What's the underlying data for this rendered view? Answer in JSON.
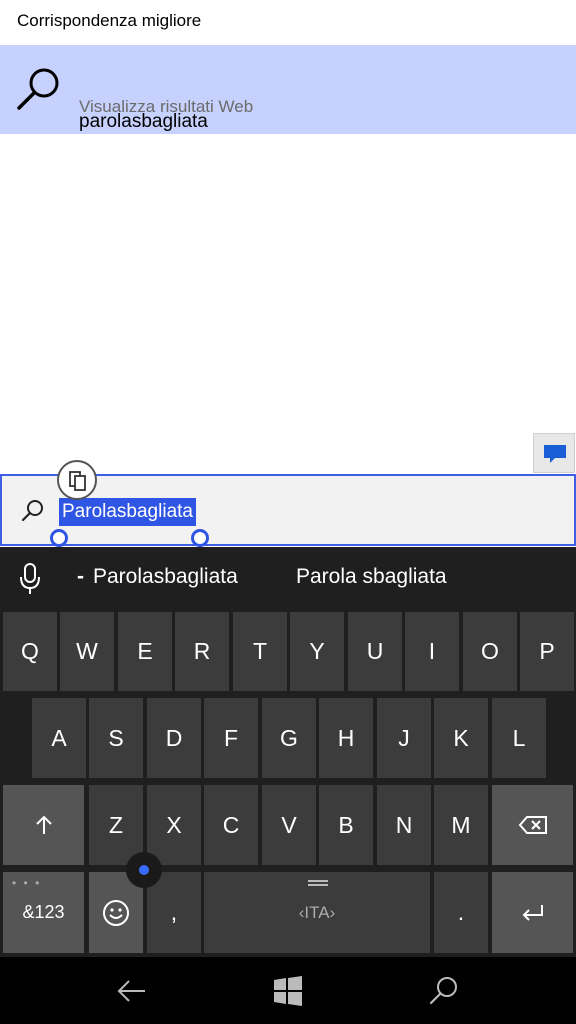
{
  "header": {
    "title": "Corrispondenza migliore"
  },
  "best_match": {
    "title": "parolasbagliata",
    "subtitle": "Visualizza risultati Web"
  },
  "search": {
    "value": "Parolasbagliata"
  },
  "suggestions": {
    "items": [
      "Parolasbagliata",
      "Parola sbagliata"
    ]
  },
  "keyboard": {
    "row1": [
      "Q",
      "W",
      "E",
      "R",
      "T",
      "Y",
      "U",
      "I",
      "O",
      "P"
    ],
    "row2": [
      "A",
      "S",
      "D",
      "F",
      "G",
      "H",
      "J",
      "K",
      "L"
    ],
    "row3": [
      "Z",
      "X",
      "C",
      "V",
      "B",
      "N",
      "M"
    ],
    "numbers_label": "&123",
    "comma": ",",
    "language": "ITA",
    "period": "."
  },
  "colors": {
    "accent": "#2f55e4",
    "highlight": "#c7d1fd",
    "keyboard_bg": "#1f1f1f",
    "key": "#3c3c3c"
  }
}
